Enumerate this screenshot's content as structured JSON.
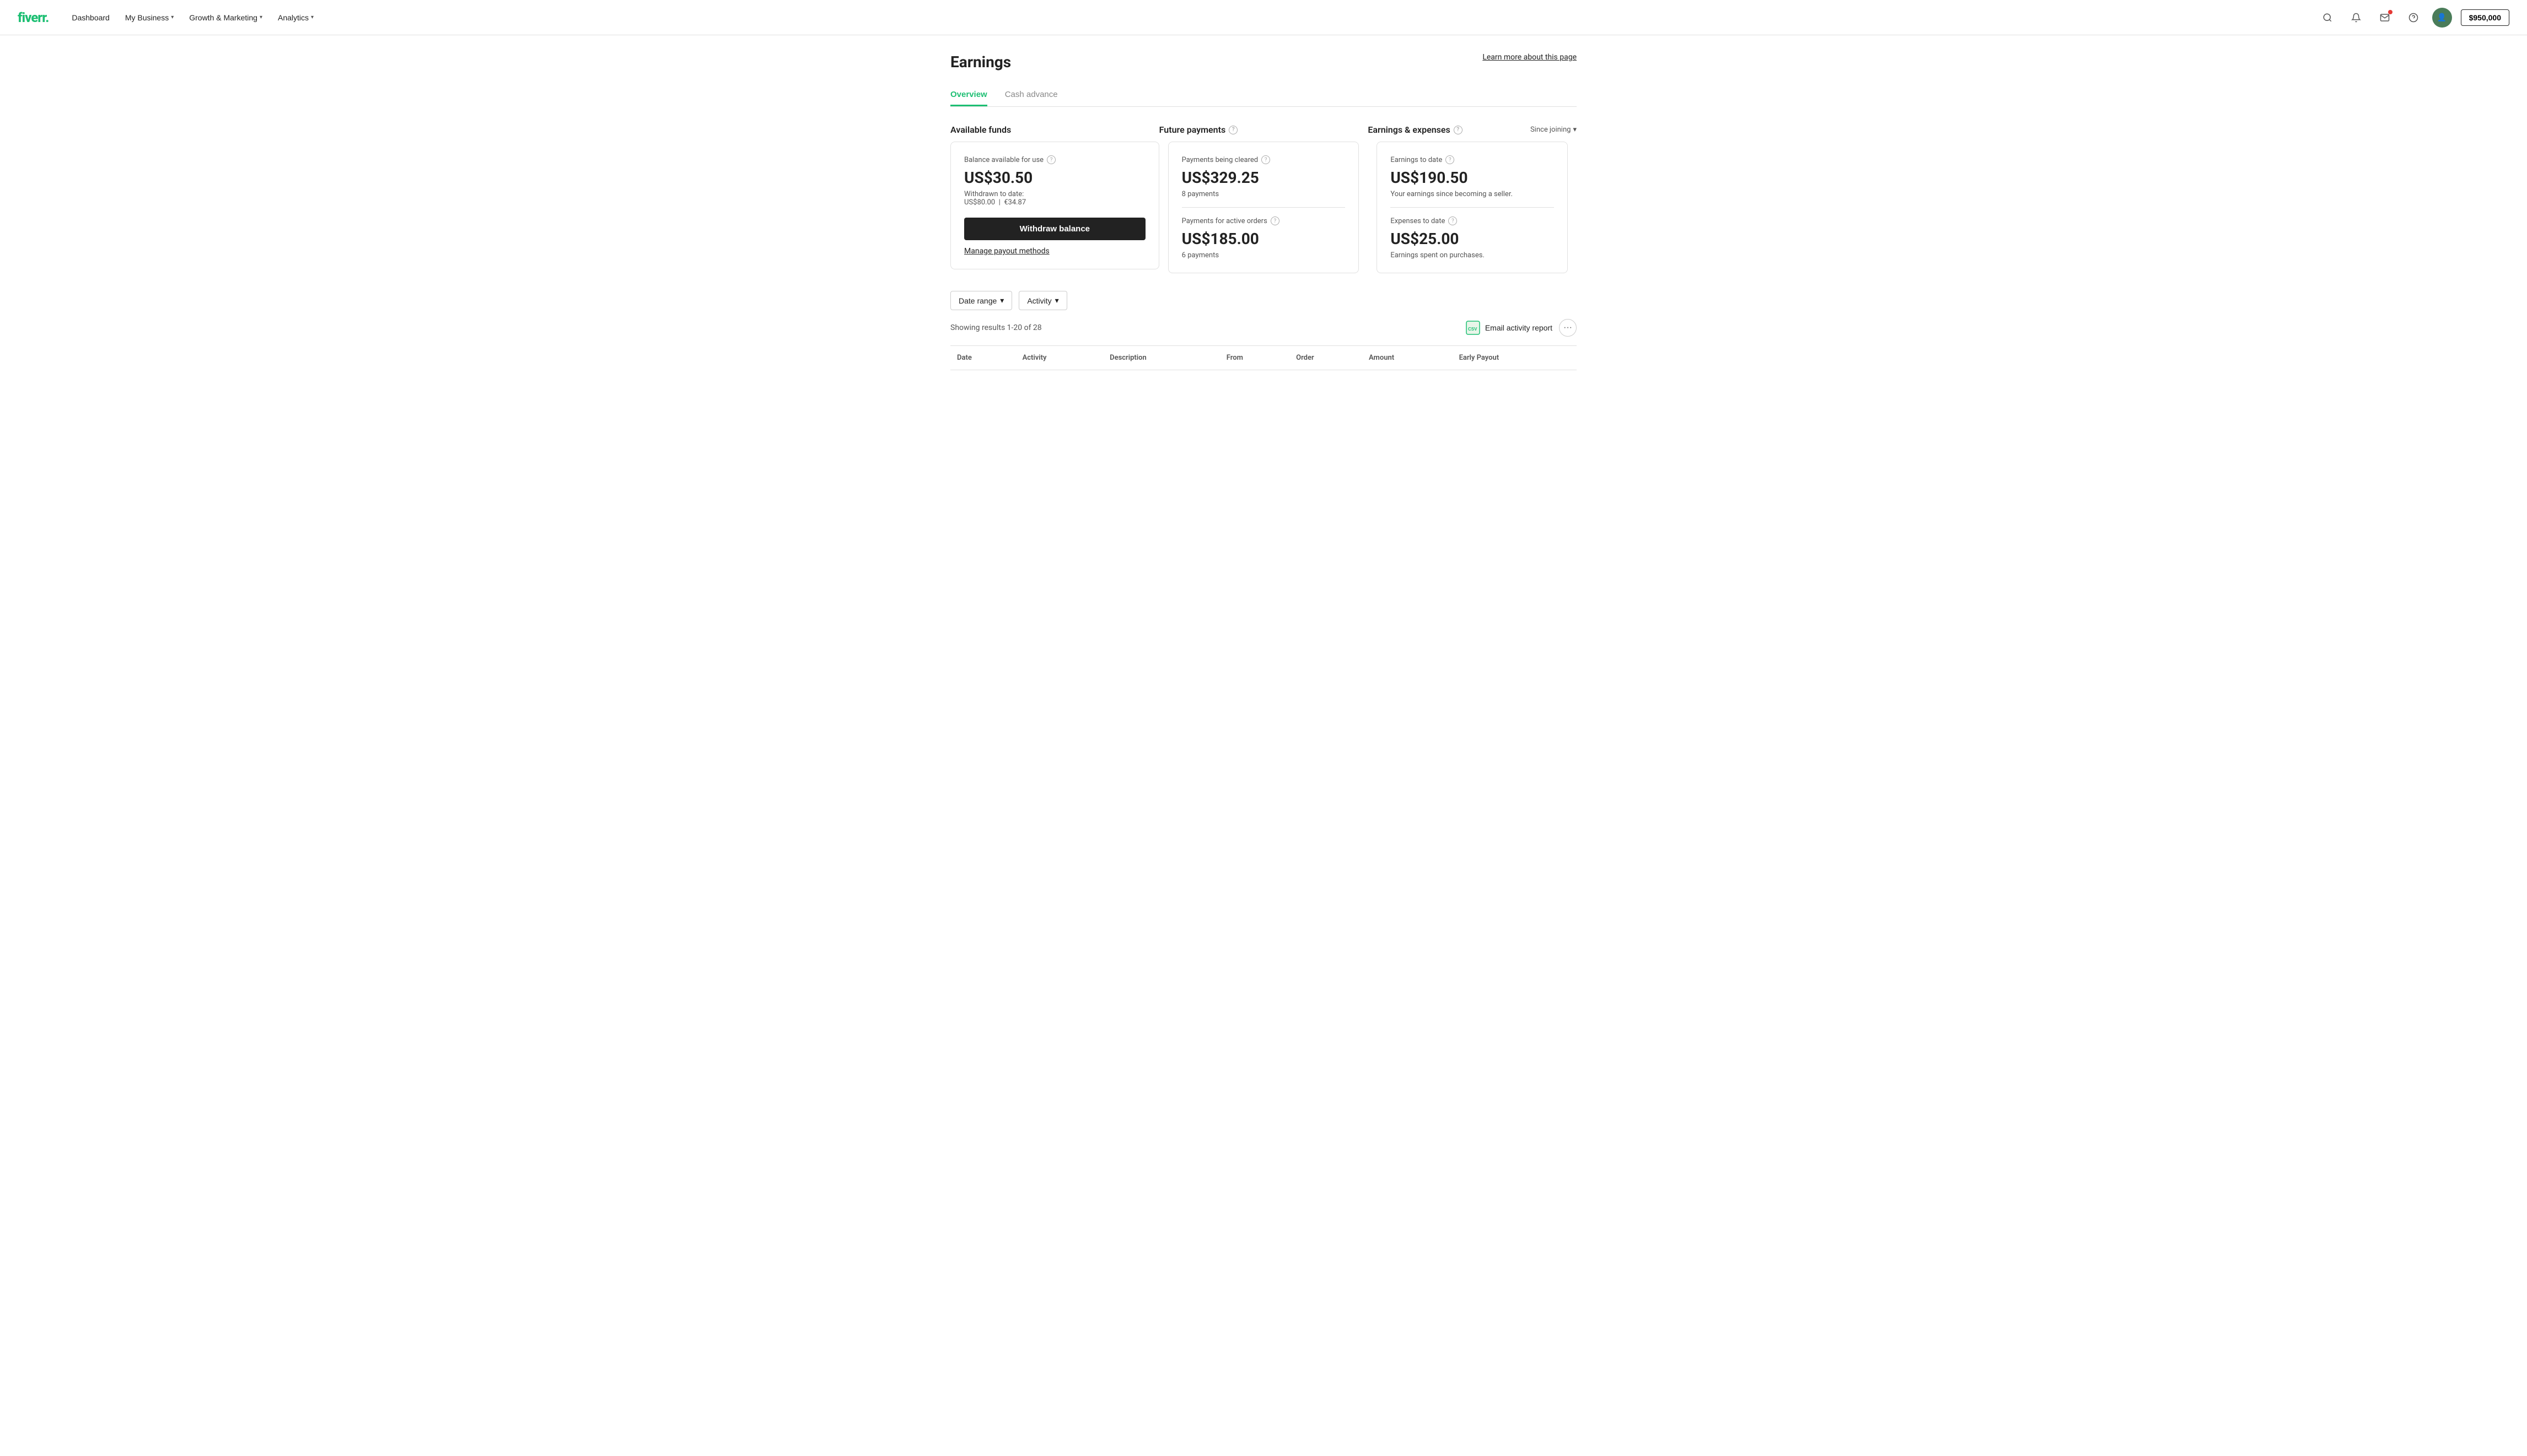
{
  "nav": {
    "logo": "fiverr",
    "logo_dot": ".",
    "links": [
      {
        "label": "Dashboard",
        "has_dropdown": false
      },
      {
        "label": "My Business",
        "has_dropdown": true
      },
      {
        "label": "Growth & Marketing",
        "has_dropdown": true
      },
      {
        "label": "Analytics",
        "has_dropdown": true
      }
    ],
    "balance": "$950,000"
  },
  "page": {
    "title": "Earnings",
    "learn_more": "Learn more about this page"
  },
  "tabs": [
    {
      "label": "Overview",
      "active": true
    },
    {
      "label": "Cash advance",
      "active": false
    }
  ],
  "available_funds": {
    "section_title": "Available funds",
    "card": {
      "label": "Balance available for use",
      "amount": "US$30.50",
      "withdrawn_label": "Withdrawn to date:",
      "withdrawn_usd": "US$80.00",
      "withdrawn_sep": "|",
      "withdrawn_eur": "€34.87",
      "withdraw_btn": "Withdraw balance",
      "manage_link": "Manage payout methods"
    }
  },
  "future_payments": {
    "section_title": "Future payments",
    "card1": {
      "label": "Payments being cleared",
      "amount": "US$329.25",
      "sub": "8 payments"
    },
    "card2": {
      "label": "Payments for active orders",
      "amount": "US$185.00",
      "sub": "6 payments"
    }
  },
  "earnings_expenses": {
    "section_title": "Earnings & expenses",
    "since_joining": "Since joining",
    "card1": {
      "label": "Earnings to date",
      "amount": "US$190.50",
      "sub": "Your earnings since becoming a seller."
    },
    "card2": {
      "label": "Expenses to date",
      "amount": "US$25.00",
      "sub": "Earnings spent on purchases."
    }
  },
  "filters": {
    "date_range": "Date range",
    "activity": "Activity"
  },
  "results": {
    "text": "Showing results 1-20 of 28",
    "email_report": "Email activity report",
    "more": "···"
  },
  "table": {
    "columns": [
      "Date",
      "Activity",
      "Description",
      "From",
      "Order",
      "Amount",
      "Early Payout"
    ]
  }
}
